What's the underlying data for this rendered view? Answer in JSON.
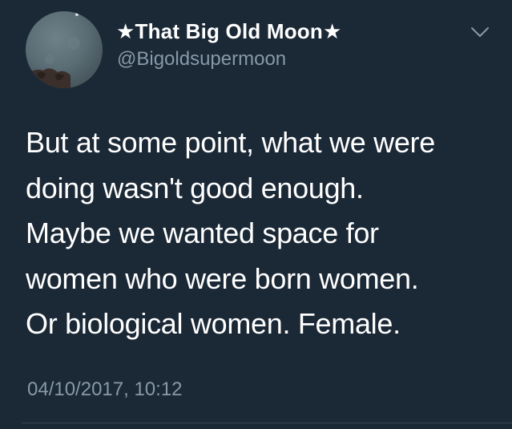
{
  "tweet": {
    "author": {
      "display_name": "★That Big Old Moon★",
      "handle": "@Bigoldsupermoon",
      "avatar": "moon-avatar"
    },
    "menu_icon": "chevron-down-icon",
    "text_lines": [
      "But at some point, what we were",
      "doing wasn't good enough.",
      "Maybe we wanted space for",
      "women who were born women.",
      "Or biological women. Female."
    ],
    "timestamp": "04/10/2017, 10:12"
  },
  "colors": {
    "background": "#1b2836",
    "primary_text": "#ffffff",
    "secondary_text": "#8899a6",
    "divider": "#38444d"
  }
}
